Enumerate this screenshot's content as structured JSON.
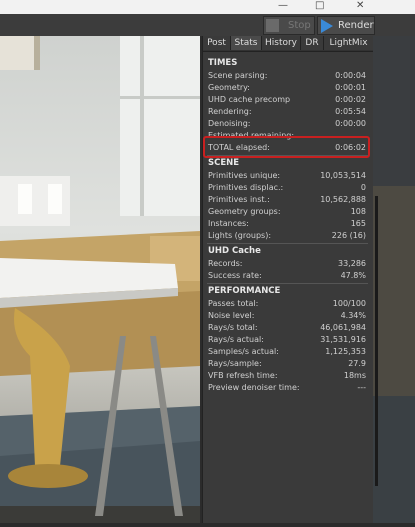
{
  "window": {
    "max_glyph": "□"
  },
  "toolbar": {
    "stop_label": "Stop",
    "render_label": "Render"
  },
  "tabs": [
    "Post",
    "Stats",
    "History",
    "DR",
    "LightMix"
  ],
  "active_tab": "Stats",
  "sections": {
    "times": {
      "header": "TIMES",
      "rows": [
        {
          "k": "Scene parsing:",
          "v": "0:00:04"
        },
        {
          "k": "Geometry:",
          "v": "0:00:01"
        },
        {
          "k": "UHD cache precomp",
          "v": "0:00:02"
        },
        {
          "k": "Rendering:",
          "v": "0:05:54"
        },
        {
          "k": "Denoising:",
          "v": "0:00:00"
        },
        {
          "k": "Estimated remaining:",
          "v": ""
        },
        {
          "k": "TOTAL elapsed:",
          "v": "0:06:02"
        }
      ]
    },
    "scene": {
      "header": "SCENE",
      "rows": [
        {
          "k": "Primitives unique:",
          "v": "10,053,514"
        },
        {
          "k": "Primitives displac.:",
          "v": "0"
        },
        {
          "k": "Primitives inst.:",
          "v": "10,562,888"
        },
        {
          "k": "Geometry groups:",
          "v": "108"
        },
        {
          "k": "Instances:",
          "v": "165"
        },
        {
          "k": "Lights (groups):",
          "v": "226 (16)"
        }
      ]
    },
    "uhd": {
      "header": "UHD Cache",
      "rows": [
        {
          "k": "Records:",
          "v": "33,286"
        },
        {
          "k": "Success rate:",
          "v": "47.8%"
        }
      ]
    },
    "performance": {
      "header": "PERFORMANCE",
      "rows": [
        {
          "k": "Passes total:",
          "v": "100/100"
        },
        {
          "k": "Noise level:",
          "v": "4.34%"
        },
        {
          "k": "Rays/s total:",
          "v": "46,061,984"
        },
        {
          "k": "Rays/s actual:",
          "v": "31,531,916"
        },
        {
          "k": "Samples/s actual:",
          "v": "1,125,353"
        },
        {
          "k": "Rays/sample:",
          "v": "27.9"
        },
        {
          "k": "VFB refresh time:",
          "v": "18ms"
        },
        {
          "k": "Preview denoiser time:",
          "v": "---"
        }
      ]
    }
  },
  "colors": {
    "highlight": "#c82020",
    "render_accent": "#3a8ad8"
  }
}
